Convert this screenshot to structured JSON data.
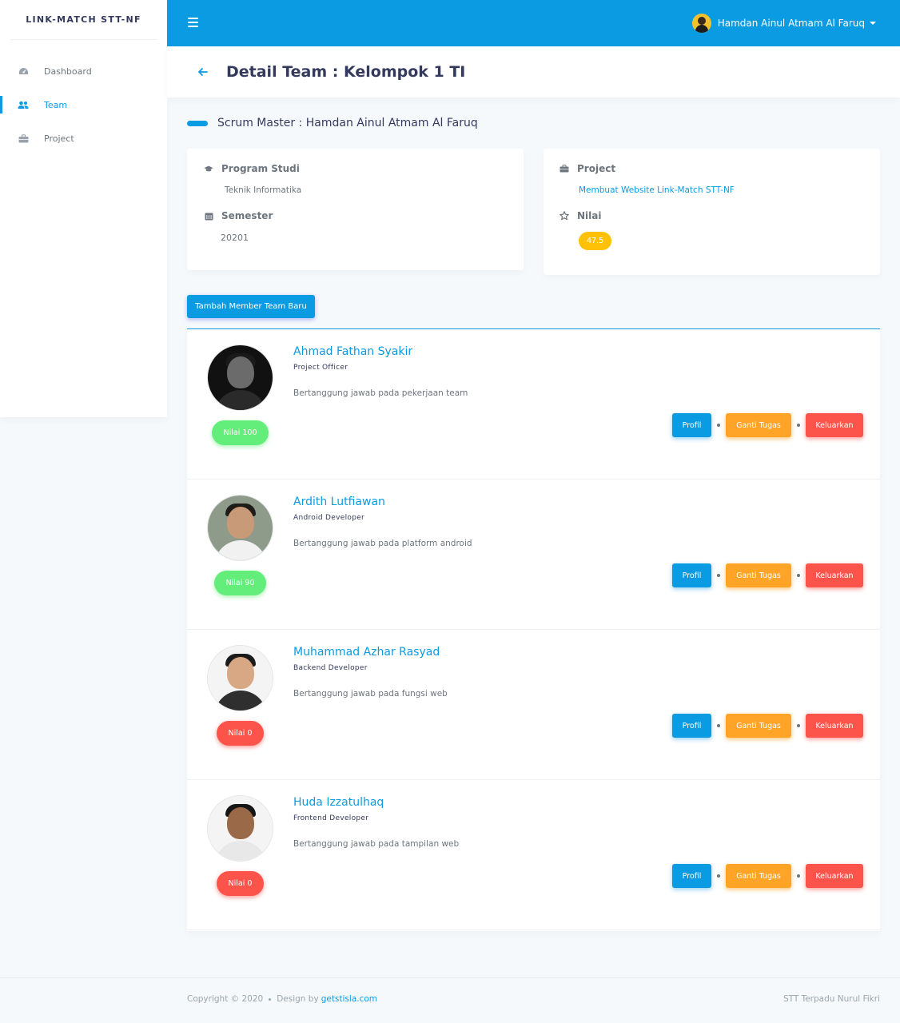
{
  "sidebar": {
    "brand": "LINK-MATCH STT-NF",
    "items": [
      {
        "label": "Dashboard",
        "icon": "dashboard-icon",
        "active": false
      },
      {
        "label": "Team",
        "icon": "users-icon",
        "active": true
      },
      {
        "label": "Project",
        "icon": "briefcase-icon",
        "active": false
      }
    ]
  },
  "navbar": {
    "user_name": "Hamdan Ainul Atmam Al Faruq"
  },
  "header": {
    "title": "Detail Team : Kelompok 1 TI"
  },
  "scrum_master": "Scrum Master : Hamdan Ainul Atmam Al Faruq",
  "info_left": {
    "program_label": "Program Studi",
    "program_value": "Teknik Informatika",
    "semester_label": "Semester",
    "semester_value": "20201"
  },
  "info_right": {
    "project_label": "Project",
    "project_value": "Membuat Website Link-Match STT-NF",
    "nilai_label": "Nilai",
    "nilai_value": "47.5"
  },
  "add_button": "Tambah Member Team Baru",
  "actions": {
    "profil": "Profil",
    "ganti": "Ganti Tugas",
    "keluar": "Keluarkan"
  },
  "members": [
    {
      "name": "Ahmad Fathan Syakir",
      "role": "Project Officer",
      "desc": "Bertanggung jawab pada pekerjaan team",
      "nilai": "Nilai 100",
      "status": "success"
    },
    {
      "name": "Ardith Lutfiawan",
      "role": "Android Developer",
      "desc": "Bertanggung jawab pada platform android",
      "nilai": "Nilai 90",
      "status": "success"
    },
    {
      "name": "Muhammad Azhar Rasyad",
      "role": "Backend Developer",
      "desc": "Bertanggung jawab pada fungsi web",
      "nilai": "Nilai 0",
      "status": "danger"
    },
    {
      "name": "Huda Izzatulhaq",
      "role": "Frontend Developer",
      "desc": "Bertanggung jawab pada tampilan web",
      "nilai": "Nilai 0",
      "status": "danger"
    }
  ],
  "footer": {
    "copyright": "Copyright © 2020",
    "design_by": "Design by",
    "design_link": "getstisla.com",
    "right": "STT Terpadu Nurul Fikri"
  },
  "colors": {
    "primary": "#0a9be3",
    "success": "#63ed7a",
    "warning": "#ffc107",
    "orange": "#ffa426",
    "danger": "#fc544b"
  }
}
